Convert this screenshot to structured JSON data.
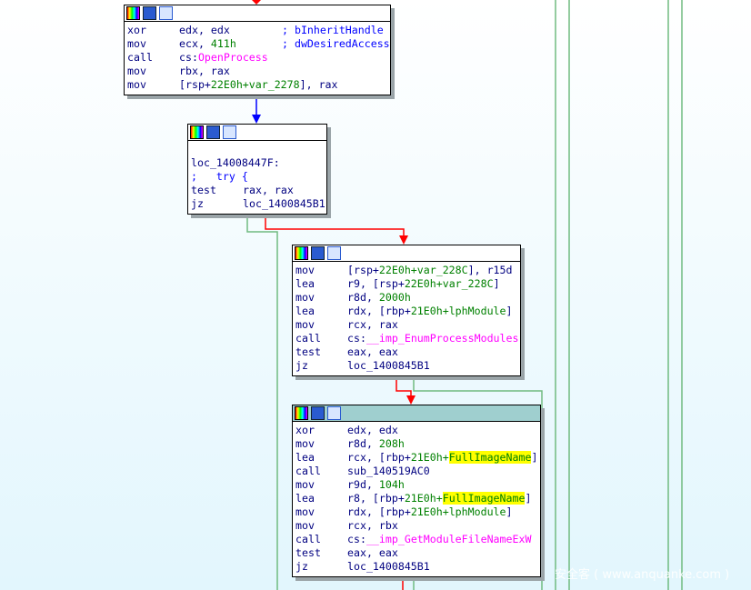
{
  "colors": {
    "true_edge": "#70bb80",
    "false_edge": "#ff0000",
    "normal_edge": "#0000ff",
    "selected_header": "#9fcfcf",
    "highlight": "#ffff00"
  },
  "header_icons": [
    "color-icon",
    "edit-icon",
    "graph-icon"
  ],
  "blocks": [
    {
      "lines": [
        {
          "m": "xor",
          "a": "edx, edx",
          "cm": "; bInheritHandle"
        },
        {
          "m": "mov",
          "a": "ecx, ",
          "n": "411h",
          "cm": "; dwDesiredAccess"
        },
        {
          "m": "call",
          "a": "cs:",
          "f": "OpenProcess"
        },
        {
          "m": "mov",
          "a": "rbx, rax"
        },
        {
          "m": "mov",
          "a": "[rsp+",
          "n": "22E0h+var_2278",
          "b": "], rax"
        }
      ]
    },
    {
      "label": "loc_14008447F:",
      "try": ";   try {",
      "lines": [
        {
          "m": "test",
          "a": "rax, rax"
        },
        {
          "m": "jz",
          "a": "loc_1400845B1"
        }
      ]
    },
    {
      "lines": [
        {
          "m": "mov",
          "a": "[rsp+",
          "n": "22E0h+var_228C",
          "b": "], r15d"
        },
        {
          "m": "lea",
          "a": "r9, [rsp+",
          "n": "22E0h+var_228C",
          "b": "]"
        },
        {
          "m": "mov",
          "a": "r8d, ",
          "n": "2000h"
        },
        {
          "m": "lea",
          "a": "rdx, [rbp+",
          "n": "21E0h+lphModule",
          "b": "]"
        },
        {
          "m": "mov",
          "a": "rcx, rax"
        },
        {
          "m": "call",
          "a": "cs:",
          "f": "__imp_EnumProcessModules"
        },
        {
          "m": "test",
          "a": "eax, eax"
        },
        {
          "m": "jz",
          "a": "loc_1400845B1"
        }
      ]
    },
    {
      "lines": [
        {
          "m": "xor",
          "a": "edx, edx"
        },
        {
          "m": "mov",
          "a": "r8d, ",
          "n": "208h"
        },
        {
          "m": "lea",
          "a": "rcx, [rbp+",
          "n": "21E0h+",
          "h": "FullImageName",
          "b": "]"
        },
        {
          "m": "call",
          "a": "sub_140519AC0"
        },
        {
          "m": "mov",
          "a": "r9d, ",
          "n": "104h"
        },
        {
          "m": "lea",
          "a": "r8, [rbp+",
          "n": "21E0h+",
          "h": "FullImageName",
          "b": "]"
        },
        {
          "m": "mov",
          "a": "rdx, [rbp+",
          "n": "21E0h+lphModule",
          "b": "]"
        },
        {
          "m": "mov",
          "a": "rcx, rbx"
        },
        {
          "m": "call",
          "a": "cs:",
          "f": "__imp_GetModuleFileNameExW"
        },
        {
          "m": "test",
          "a": "eax, eax"
        },
        {
          "m": "jz",
          "a": "loc_1400845B1"
        }
      ]
    }
  ],
  "watermark": "安全客 ( www.anquanke.com )"
}
